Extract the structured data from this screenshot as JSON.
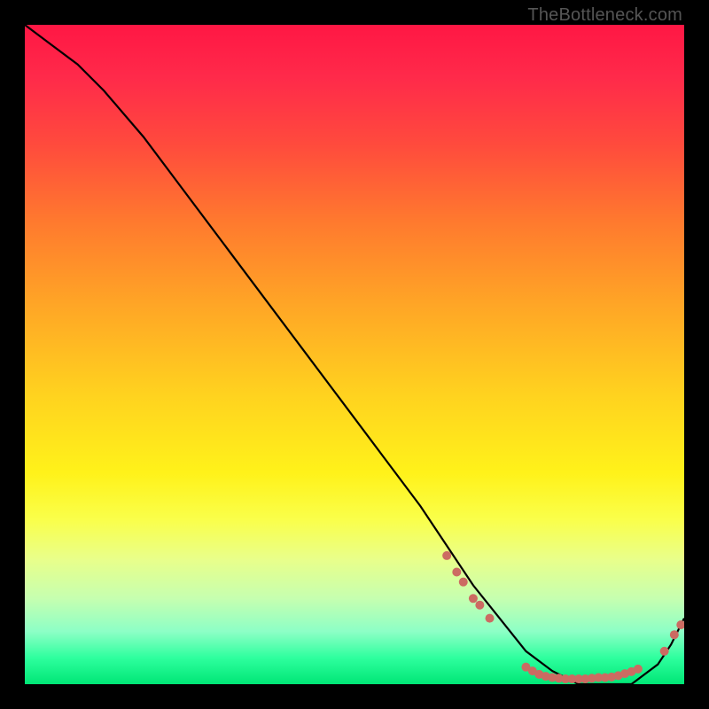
{
  "attribution": "TheBottleneck.com",
  "colors": {
    "dot": "#cc6b62",
    "curve": "#000000",
    "frame": "#000000"
  },
  "chart_data": {
    "type": "line",
    "title": "",
    "xlabel": "",
    "ylabel": "",
    "xlim": [
      0,
      100
    ],
    "ylim": [
      0,
      100
    ],
    "grid": false,
    "legend": false,
    "series": [
      {
        "name": "bottleneck-curve",
        "x": [
          0,
          4,
          8,
          12,
          18,
          24,
          30,
          36,
          42,
          48,
          54,
          60,
          64,
          68,
          72,
          76,
          80,
          84,
          88,
          92,
          96,
          98,
          100
        ],
        "y": [
          100,
          97,
          94,
          90,
          83,
          75,
          67,
          59,
          51,
          43,
          35,
          27,
          21,
          15,
          10,
          5,
          2,
          0,
          0,
          0,
          3,
          6,
          10
        ]
      }
    ],
    "markers": [
      {
        "x": 64.0,
        "y": 19.5
      },
      {
        "x": 65.5,
        "y": 17.0
      },
      {
        "x": 66.5,
        "y": 15.5
      },
      {
        "x": 68.0,
        "y": 13.0
      },
      {
        "x": 69.0,
        "y": 12.0
      },
      {
        "x": 70.5,
        "y": 10.0
      },
      {
        "x": 76.0,
        "y": 2.6
      },
      {
        "x": 77.0,
        "y": 2.0
      },
      {
        "x": 78.0,
        "y": 1.5
      },
      {
        "x": 79.0,
        "y": 1.2
      },
      {
        "x": 80.0,
        "y": 1.0
      },
      {
        "x": 81.0,
        "y": 0.9
      },
      {
        "x": 82.0,
        "y": 0.8
      },
      {
        "x": 83.0,
        "y": 0.8
      },
      {
        "x": 84.0,
        "y": 0.8
      },
      {
        "x": 85.0,
        "y": 0.8
      },
      {
        "x": 86.0,
        "y": 0.9
      },
      {
        "x": 87.0,
        "y": 1.0
      },
      {
        "x": 88.0,
        "y": 1.0
      },
      {
        "x": 89.0,
        "y": 1.1
      },
      {
        "x": 90.0,
        "y": 1.3
      },
      {
        "x": 91.0,
        "y": 1.6
      },
      {
        "x": 92.0,
        "y": 1.9
      },
      {
        "x": 93.0,
        "y": 2.3
      },
      {
        "x": 97.0,
        "y": 5.0
      },
      {
        "x": 98.5,
        "y": 7.5
      },
      {
        "x": 99.5,
        "y": 9.0
      }
    ]
  }
}
